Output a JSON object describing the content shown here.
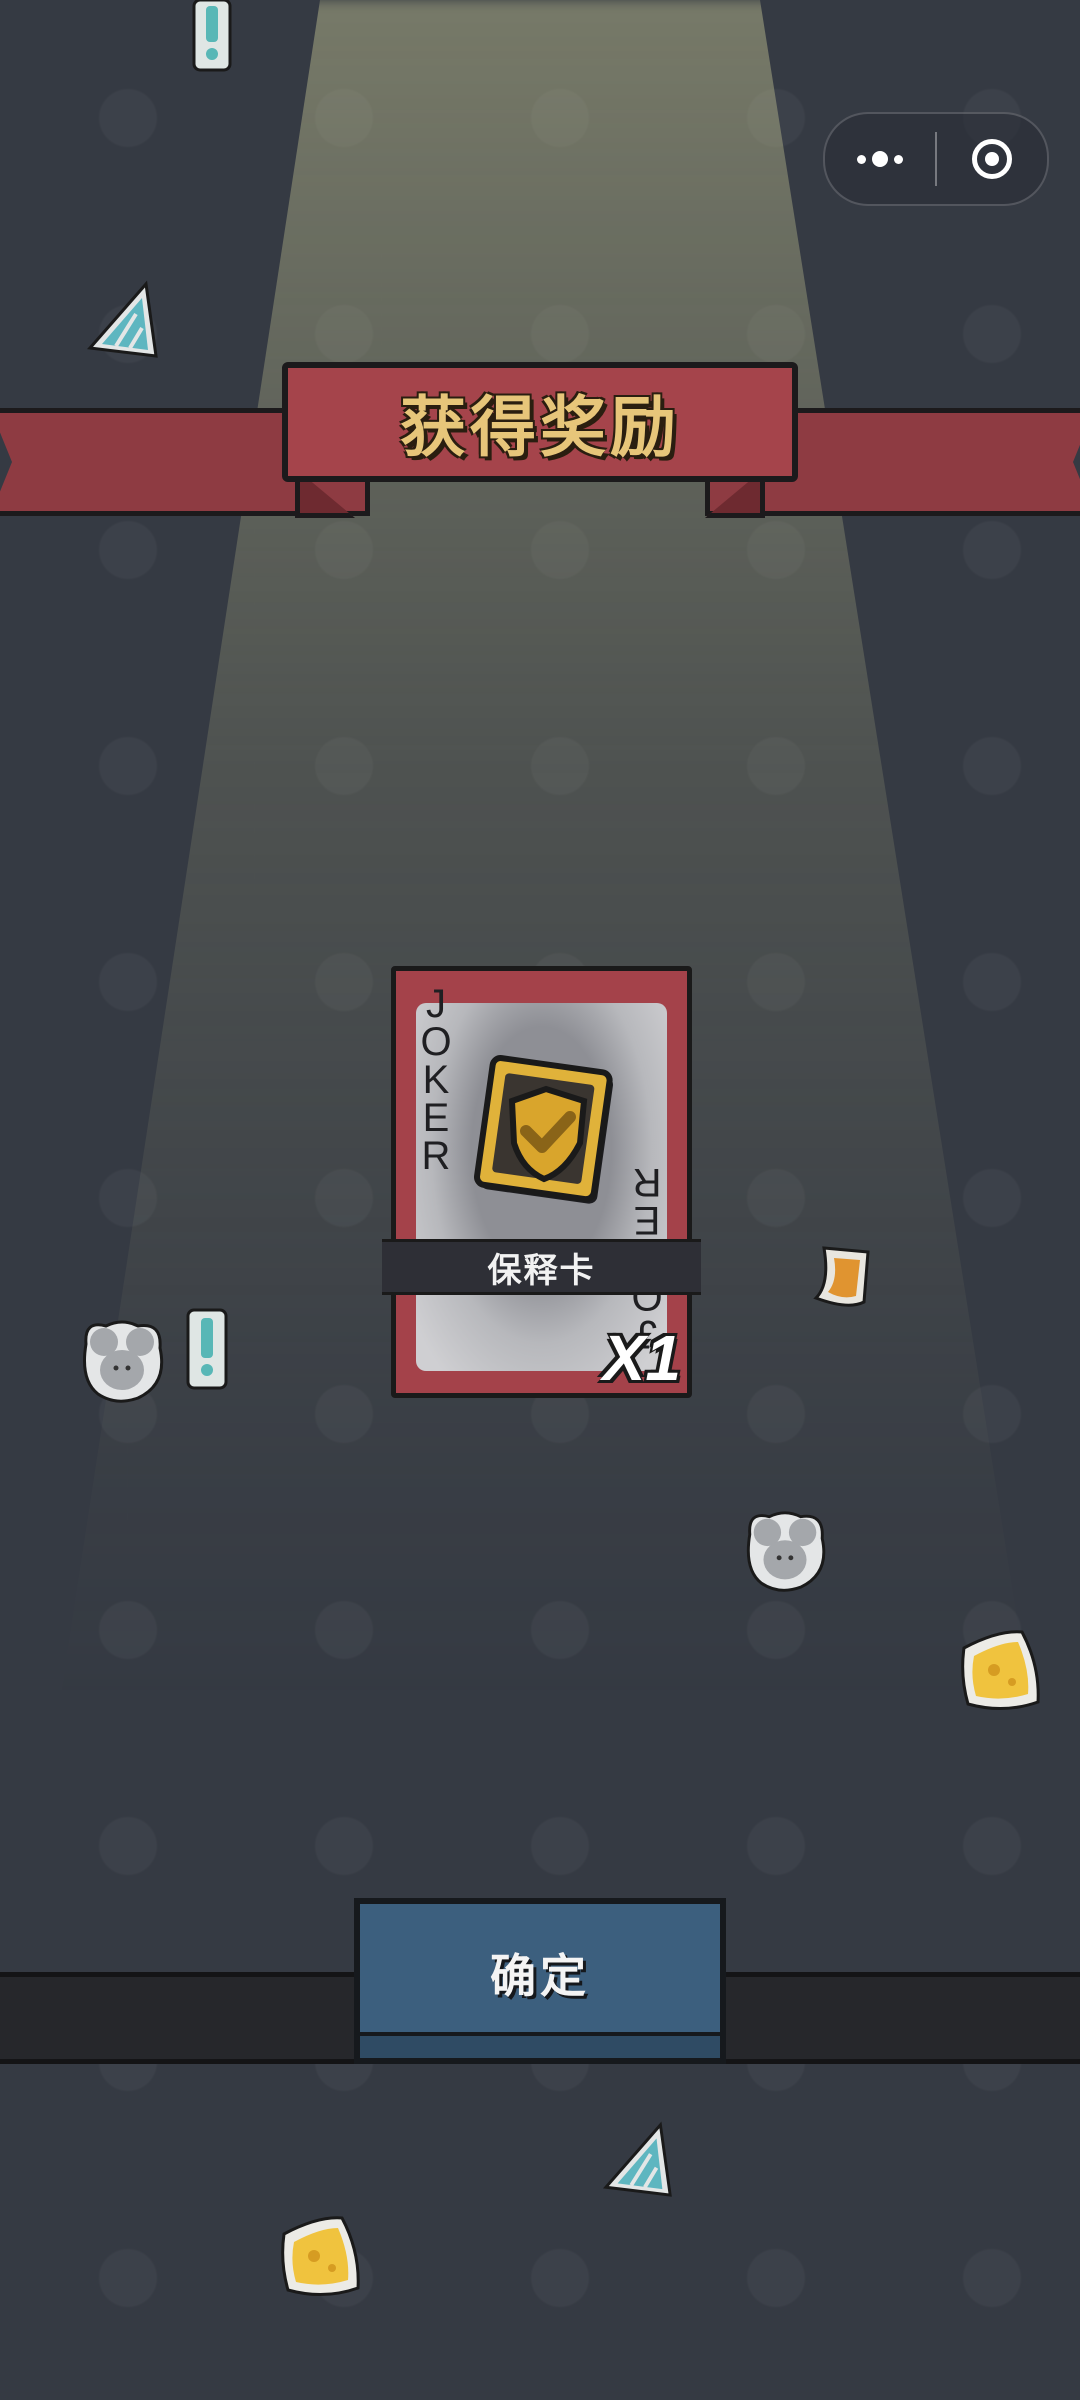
{
  "topbar": {
    "more_icon": "more-dots-icon",
    "close_icon": "target-circle-icon"
  },
  "banner": {
    "title": "获得奖励"
  },
  "reward_card": {
    "card_text": "JOKER",
    "item_name": "保释卡",
    "quantity": "X1",
    "icon": "shield-check-icon",
    "colors": {
      "frame": "#a4424a",
      "inner": "#c7c8ca",
      "label_bar": "#2e2f36"
    }
  },
  "actions": {
    "confirm_label": "确定",
    "confirm_color": "#3c5f7e"
  },
  "decorations": [
    "exclamation-icon",
    "triangle-gem-icon",
    "mouse-face-icon",
    "cheese-icon",
    "paper-scrap-icon"
  ]
}
